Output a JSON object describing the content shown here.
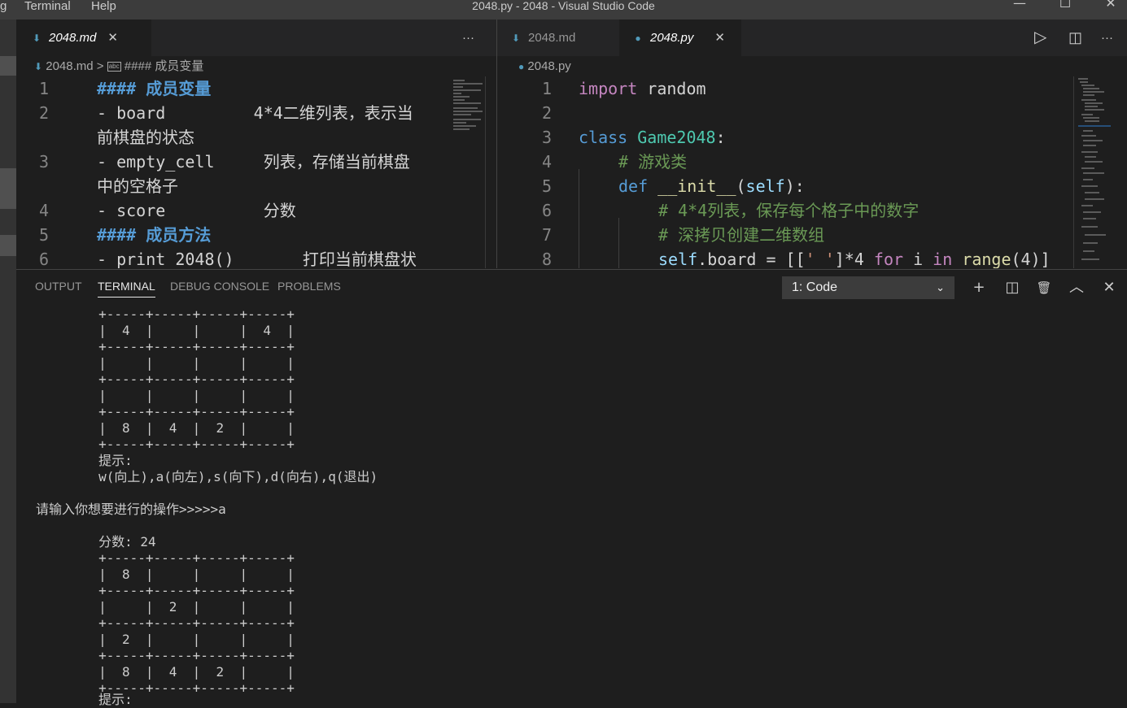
{
  "window": {
    "title": "2048.py - 2048 - Visual Studio Code",
    "menu": [
      "g",
      "Terminal",
      "Help"
    ],
    "controls": {
      "minimize": "—",
      "maximize": "☐",
      "close": "✕"
    }
  },
  "left_editor": {
    "tab": {
      "label": "2048.md",
      "icon": "markdown-icon",
      "close": "✕"
    },
    "more": "···",
    "breadcrumb": {
      "file": "2048.md",
      "separator": ">",
      "symbol_icon": "abc",
      "symbol": "#### 成员变量"
    },
    "lines": [
      {
        "n": "1",
        "text": "#### 成员变量",
        "heading": true
      },
      {
        "n": "2",
        "text": "- board         4*4二维列表，表示当",
        "heading": false
      },
      {
        "n": "",
        "text": "前棋盘的状态",
        "heading": false
      },
      {
        "n": "3",
        "text": "- empty_cell     列表，存储当前棋盘",
        "heading": false
      },
      {
        "n": "",
        "text": "中的空格子",
        "heading": false
      },
      {
        "n": "4",
        "text": "- score          分数",
        "heading": false
      },
      {
        "n": "5",
        "text": "#### 成员方法",
        "heading": true
      },
      {
        "n": "6",
        "text": "- print_2048()       打印当前棋盘状",
        "heading": false
      }
    ]
  },
  "right_editor": {
    "tabs": [
      {
        "label": "2048.md",
        "icon": "markdown-icon"
      },
      {
        "label": "2048.py",
        "icon": "python-icon",
        "close": "✕"
      }
    ],
    "actions": {
      "run": "▷",
      "split": "◫",
      "more": "···"
    },
    "breadcrumb": {
      "file": "2048.py"
    },
    "line_numbers": [
      "1",
      "2",
      "3",
      "4",
      "5",
      "6",
      "7",
      "8"
    ],
    "tokens": {
      "import": "import",
      "random": " random",
      "class": "class",
      "classname": " Game2048",
      "colon": ":",
      "comment_class": "# 游戏类",
      "def": "def",
      "init": " __init__",
      "lparen": "(",
      "self": "self",
      "rparen_colon": "):",
      "comment1": "# 4*4列表，保存每个格子中的数字",
      "comment2": "# 深拷贝创建二维数组",
      "self2": "self",
      "board_assign": ".board = [[",
      "str_space": "' '",
      "times4": "]*4 ",
      "for": "for",
      "i": " i ",
      "in": "in",
      "range": " range",
      "range_arg": "(4)]"
    }
  },
  "panel": {
    "tabs": [
      "OUTPUT",
      "TERMINAL",
      "DEBUG CONSOLE",
      "PROBLEMS"
    ],
    "active_tab": "TERMINAL",
    "terminal_select": "1: Code",
    "actions": {
      "add": "+",
      "split": "◫",
      "trash": "🗑",
      "maximize": "︿",
      "close": "✕"
    },
    "terminal_lines": [
      "        +-----+-----+-----+-----+",
      "        |  4  |     |     |  4  |",
      "        +-----+-----+-----+-----+",
      "        |     |     |     |     |",
      "        +-----+-----+-----+-----+",
      "        |     |     |     |     |",
      "        +-----+-----+-----+-----+",
      "        |  8  |  4  |  2  |     |",
      "        +-----+-----+-----+-----+",
      "        提示:",
      "        w(向上),a(向左),s(向下),d(向右),q(退出)",
      "",
      "请输入你想要进行的操作>>>>>a",
      "",
      "        分数: 24",
      "        +-----+-----+-----+-----+",
      "        |  8  |     |     |     |",
      "        +-----+-----+-----+-----+",
      "        |     |  2  |     |     |",
      "        +-----+-----+-----+-----+",
      "        |  2  |     |     |     |",
      "        +-----+-----+-----+-----+",
      "        |  8  |  4  |  2  |     |",
      "        +-----+-----+-----+-----+",
      "        提示:"
    ]
  }
}
